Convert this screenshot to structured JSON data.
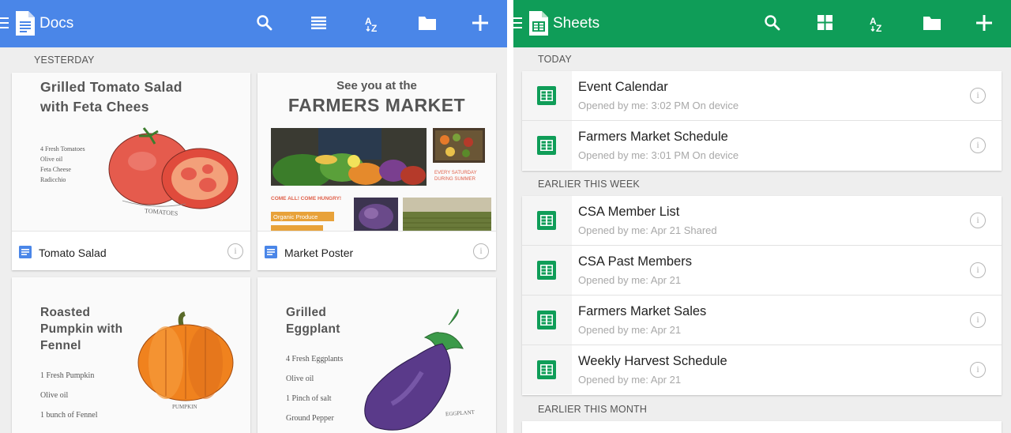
{
  "docs": {
    "title": "Docs",
    "section_label": "YESTERDAY",
    "cards": [
      {
        "name": "Tomato Salad",
        "thumb_title": "Grilled Tomato Salad with Feta Chees",
        "ingredients": [
          "4 Fresh Tomatoes",
          "Olive oil",
          "Feta Cheese",
          "Radicchio"
        ],
        "sketch_label": "TOMATOES"
      },
      {
        "name": "Market Poster",
        "thumb_title": "See you at the",
        "thumb_headline": "FARMERS MARKET",
        "tagline": "EVERY SATURDAY DURING SUMMER",
        "callout": "COME ALL! COME HUNGRY!",
        "tag1": "Organic Produce"
      },
      {
        "thumb_title": "Roasted Pumpkin with Fennel",
        "ingredients": [
          "1 Fresh Pumpkin",
          "Olive oil",
          "1 bunch of Fennel"
        ],
        "sketch_label": "PUMPKIN"
      },
      {
        "thumb_title": "Grilled Eggplant",
        "ingredients": [
          "4 Fresh Eggplants",
          "Olive oil",
          "1 Pinch of salt",
          "Ground Pepper"
        ],
        "sketch_label": "EGGPLANT"
      }
    ]
  },
  "sheets": {
    "title": "Sheets",
    "groups": [
      {
        "label": "TODAY",
        "items": [
          {
            "name": "Event Calendar",
            "meta": "Opened by me: 3:02 PM   On device"
          },
          {
            "name": "Farmers Market Schedule",
            "meta": "Opened by me: 3:01 PM   On device"
          }
        ]
      },
      {
        "label": "EARLIER THIS WEEK",
        "items": [
          {
            "name": "CSA Member List",
            "meta": "Opened by me: Apr 21   Shared"
          },
          {
            "name": "CSA Past Members",
            "meta": "Opened by me: Apr 21"
          },
          {
            "name": "Farmers Market Sales",
            "meta": "Opened by me: Apr 21"
          },
          {
            "name": "Weekly Harvest Schedule",
            "meta": "Opened by me: Apr 21"
          }
        ]
      },
      {
        "label": "EARLIER THIS MONTH",
        "items": []
      }
    ]
  },
  "info_glyph": "i",
  "icons": [
    "menu-icon",
    "docs-logo-icon",
    "sheets-logo-icon",
    "search-icon",
    "list-view-icon",
    "grid-view-icon",
    "sort-az-icon",
    "folder-icon",
    "add-icon",
    "info-icon",
    "document-icon",
    "spreadsheet-icon"
  ],
  "colors": {
    "docs_bar": "#4a86e8",
    "sheets_bar": "#0f9d58",
    "doc_icon": "#4a86e8",
    "sheet_icon": "#0f9d58",
    "background": "#eeeeee"
  }
}
